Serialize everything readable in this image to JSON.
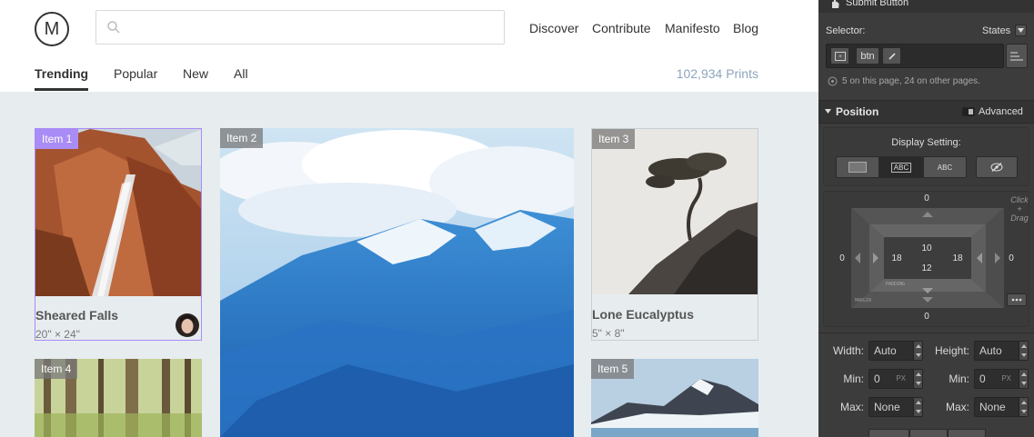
{
  "site": {
    "logo_letter": "M",
    "search": {
      "value": "",
      "placeholder": ""
    },
    "topnav": [
      "Discover",
      "Contribute",
      "Manifesto",
      "Blog"
    ],
    "subnav": [
      "Trending",
      "Popular",
      "New",
      "All"
    ],
    "prints_count": "102,934 Prints",
    "cards": [
      {
        "tag": "Item 1",
        "title": "Sheared Falls",
        "dims": "20\" × 24\"",
        "selected": true
      },
      {
        "tag": "Item 2"
      },
      {
        "tag": "Item 3",
        "title": "Lone Eucalyptus",
        "dims": "5\" × 8\""
      },
      {
        "tag": "Item 4"
      },
      {
        "tag": "Item 5"
      }
    ]
  },
  "panel": {
    "element_name": "Submit Button",
    "selector_label": "Selector:",
    "states_label": "States",
    "selector_tag": "btn",
    "selector_info": "5 on this page, 24 on other pages.",
    "position_label": "Position",
    "advanced_label": "Advanced",
    "display_setting_label": "Display Setting:",
    "display_options": [
      "ABC",
      "ABC"
    ],
    "hint_text": "Click + Drag",
    "box": {
      "margin_top": "0",
      "margin_bottom": "0",
      "margin_left": "0",
      "margin_right": "0",
      "padding_top": "10",
      "padding_bottom": "12",
      "padding_left": "18",
      "padding_right": "18",
      "padding_label": "PADDING",
      "margin_label": "MARGIN"
    },
    "size": {
      "width_label": "Width:",
      "width_value": "Auto",
      "height_label": "Height:",
      "height_value": "Auto",
      "min_label": "Min:",
      "min_w_value": "0",
      "min_h_value": "0",
      "unit": "PX",
      "max_label": "Max:",
      "max_w_value": "None",
      "max_h_value": "None"
    }
  }
}
